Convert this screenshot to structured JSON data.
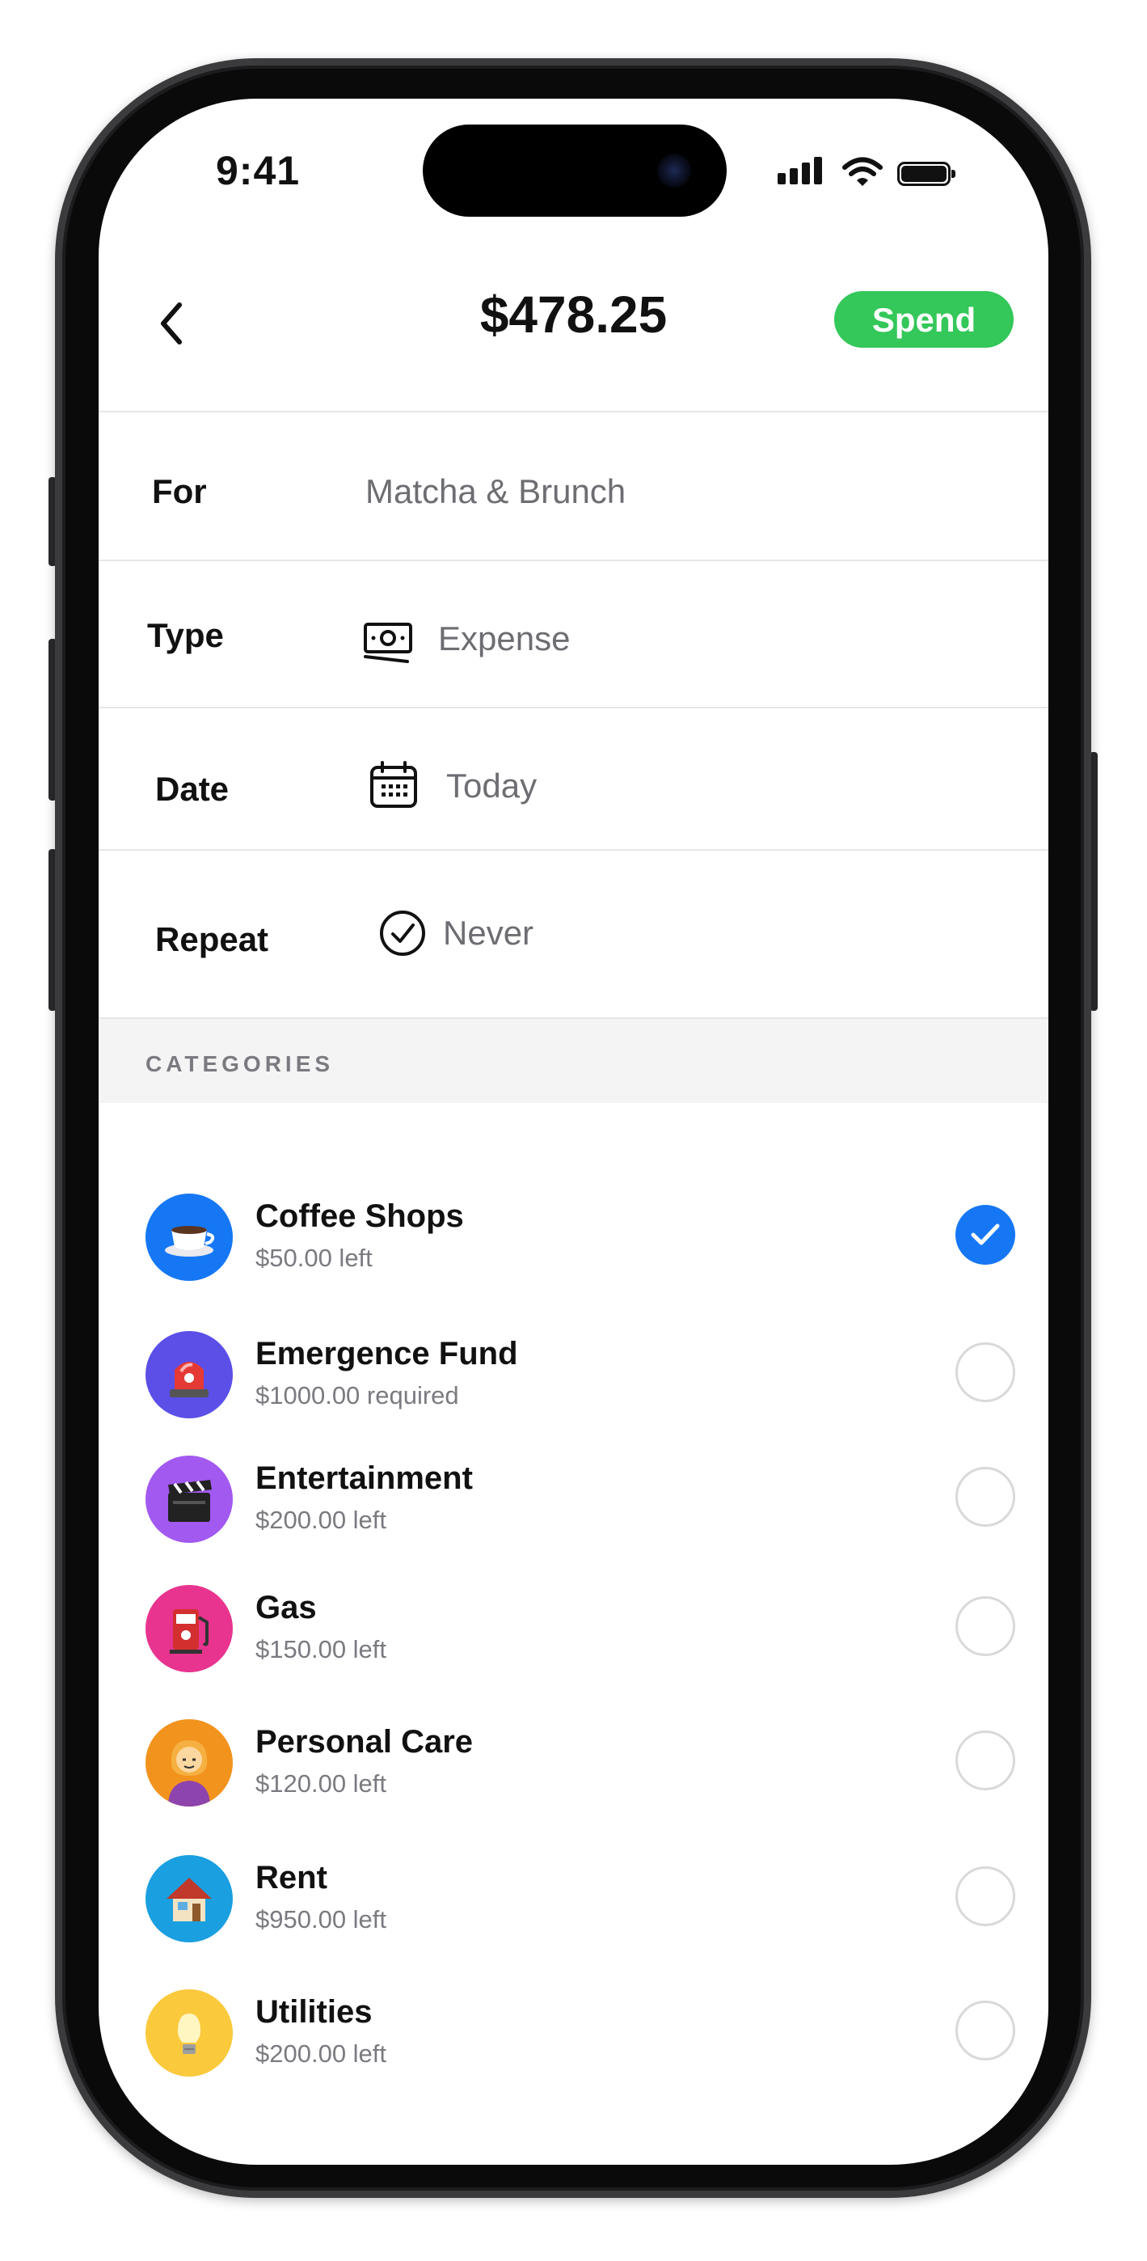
{
  "status_bar": {
    "time": "9:41"
  },
  "header": {
    "amount": "$478.25",
    "spend_label": "Spend"
  },
  "form": {
    "for": {
      "label": "For",
      "value": "Matcha & Brunch"
    },
    "type": {
      "label": "Type",
      "value": "Expense",
      "icon": "money-icon"
    },
    "date": {
      "label": "Date",
      "value": "Today",
      "icon": "calendar-icon"
    },
    "repeat": {
      "label": "Repeat",
      "value": "Never",
      "icon": "check-circle-icon"
    }
  },
  "categories": {
    "header": "CATEGORIES",
    "items": [
      {
        "name": "Coffee Shops",
        "sub": "$50.00 left",
        "icon": "coffee-icon",
        "color": "#1677f5",
        "selected": true
      },
      {
        "name": "Emergence Fund",
        "sub": "$1000.00 required",
        "icon": "siren-icon",
        "color": "#5b4fe8",
        "selected": false
      },
      {
        "name": "Entertainment",
        "sub": "$200.00 left",
        "icon": "clapperboard-icon",
        "color": "#a259f0",
        "selected": false
      },
      {
        "name": "Gas",
        "sub": "$150.00 left",
        "icon": "fuel-pump-icon",
        "color": "#e8348e",
        "selected": false
      },
      {
        "name": "Personal Care",
        "sub": "$120.00 left",
        "icon": "person-icon",
        "color": "#f2931e",
        "selected": false
      },
      {
        "name": "Rent",
        "sub": "$950.00 left",
        "icon": "house-icon",
        "color": "#1a9fe0",
        "selected": false
      },
      {
        "name": "Utilities",
        "sub": "$200.00 left",
        "icon": "light-bulb-icon",
        "color": "#fbc93c",
        "selected": false
      }
    ]
  },
  "colors": {
    "accent_green": "#34c759",
    "accent_blue": "#1677f5"
  }
}
